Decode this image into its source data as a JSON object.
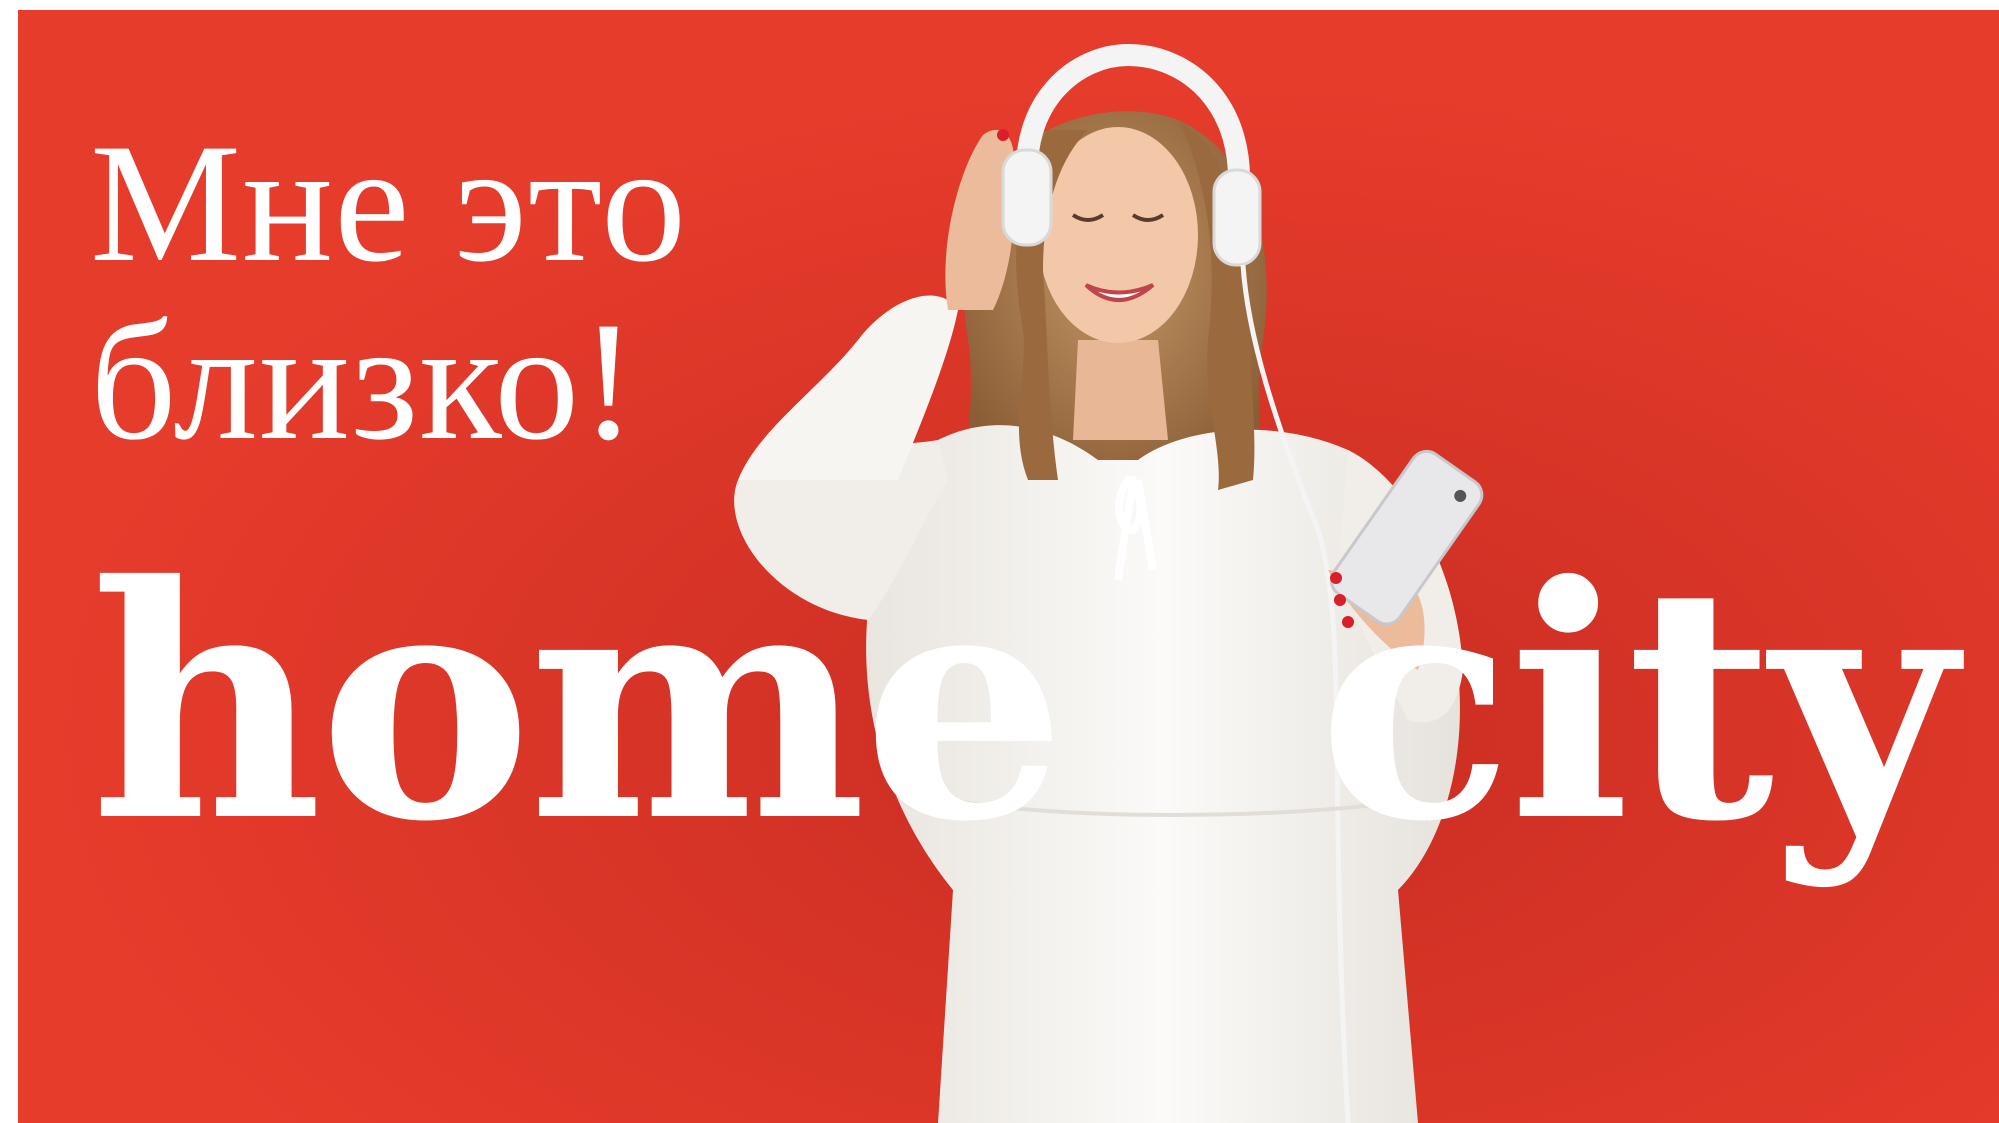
{
  "banner": {
    "background_color": "#e63c2c",
    "headline_lines": [
      "Мне это",
      "близко!"
    ],
    "brand": {
      "word_1": "home",
      "word_2": "city"
    },
    "photo": {
      "subject": "woman-with-headphones-and-smartphone",
      "dress_color": "#f6f3ef",
      "hair_color": "#a87a4c",
      "skin_color": "#f0c6a6",
      "headphones_color": "#f4f4f4",
      "nail_color": "#d81f2a"
    }
  }
}
